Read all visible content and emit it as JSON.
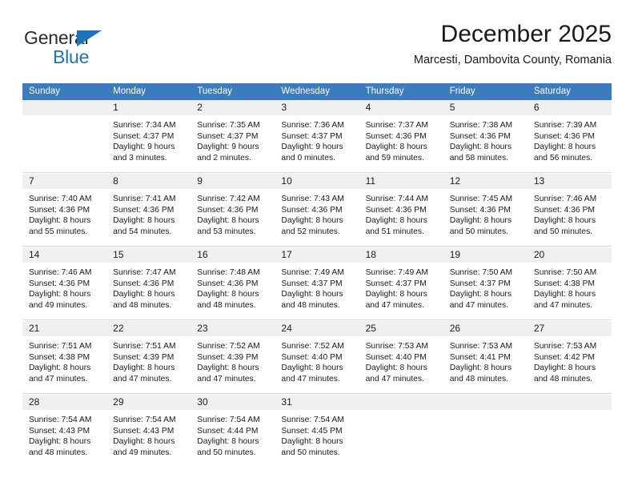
{
  "brand": {
    "name_part1": "General",
    "name_part2": "Blue",
    "triangle_color": "#1b75bb"
  },
  "header": {
    "month_title": "December 2025",
    "location": "Marcesti, Dambovita County, Romania",
    "header_bg": "#3a7cbf"
  },
  "weekday_headers": [
    "Sunday",
    "Monday",
    "Tuesday",
    "Wednesday",
    "Thursday",
    "Friday",
    "Saturday"
  ],
  "weeks": [
    [
      {
        "day": "",
        "sunrise": "",
        "sunset": "",
        "daylight1": "",
        "daylight2": ""
      },
      {
        "day": "1",
        "sunrise": "Sunrise: 7:34 AM",
        "sunset": "Sunset: 4:37 PM",
        "daylight1": "Daylight: 9 hours",
        "daylight2": "and 3 minutes."
      },
      {
        "day": "2",
        "sunrise": "Sunrise: 7:35 AM",
        "sunset": "Sunset: 4:37 PM",
        "daylight1": "Daylight: 9 hours",
        "daylight2": "and 2 minutes."
      },
      {
        "day": "3",
        "sunrise": "Sunrise: 7:36 AM",
        "sunset": "Sunset: 4:37 PM",
        "daylight1": "Daylight: 9 hours",
        "daylight2": "and 0 minutes."
      },
      {
        "day": "4",
        "sunrise": "Sunrise: 7:37 AM",
        "sunset": "Sunset: 4:36 PM",
        "daylight1": "Daylight: 8 hours",
        "daylight2": "and 59 minutes."
      },
      {
        "day": "5",
        "sunrise": "Sunrise: 7:38 AM",
        "sunset": "Sunset: 4:36 PM",
        "daylight1": "Daylight: 8 hours",
        "daylight2": "and 58 minutes."
      },
      {
        "day": "6",
        "sunrise": "Sunrise: 7:39 AM",
        "sunset": "Sunset: 4:36 PM",
        "daylight1": "Daylight: 8 hours",
        "daylight2": "and 56 minutes."
      }
    ],
    [
      {
        "day": "7",
        "sunrise": "Sunrise: 7:40 AM",
        "sunset": "Sunset: 4:36 PM",
        "daylight1": "Daylight: 8 hours",
        "daylight2": "and 55 minutes."
      },
      {
        "day": "8",
        "sunrise": "Sunrise: 7:41 AM",
        "sunset": "Sunset: 4:36 PM",
        "daylight1": "Daylight: 8 hours",
        "daylight2": "and 54 minutes."
      },
      {
        "day": "9",
        "sunrise": "Sunrise: 7:42 AM",
        "sunset": "Sunset: 4:36 PM",
        "daylight1": "Daylight: 8 hours",
        "daylight2": "and 53 minutes."
      },
      {
        "day": "10",
        "sunrise": "Sunrise: 7:43 AM",
        "sunset": "Sunset: 4:36 PM",
        "daylight1": "Daylight: 8 hours",
        "daylight2": "and 52 minutes."
      },
      {
        "day": "11",
        "sunrise": "Sunrise: 7:44 AM",
        "sunset": "Sunset: 4:36 PM",
        "daylight1": "Daylight: 8 hours",
        "daylight2": "and 51 minutes."
      },
      {
        "day": "12",
        "sunrise": "Sunrise: 7:45 AM",
        "sunset": "Sunset: 4:36 PM",
        "daylight1": "Daylight: 8 hours",
        "daylight2": "and 50 minutes."
      },
      {
        "day": "13",
        "sunrise": "Sunrise: 7:46 AM",
        "sunset": "Sunset: 4:36 PM",
        "daylight1": "Daylight: 8 hours",
        "daylight2": "and 50 minutes."
      }
    ],
    [
      {
        "day": "14",
        "sunrise": "Sunrise: 7:46 AM",
        "sunset": "Sunset: 4:36 PM",
        "daylight1": "Daylight: 8 hours",
        "daylight2": "and 49 minutes."
      },
      {
        "day": "15",
        "sunrise": "Sunrise: 7:47 AM",
        "sunset": "Sunset: 4:36 PM",
        "daylight1": "Daylight: 8 hours",
        "daylight2": "and 48 minutes."
      },
      {
        "day": "16",
        "sunrise": "Sunrise: 7:48 AM",
        "sunset": "Sunset: 4:36 PM",
        "daylight1": "Daylight: 8 hours",
        "daylight2": "and 48 minutes."
      },
      {
        "day": "17",
        "sunrise": "Sunrise: 7:49 AM",
        "sunset": "Sunset: 4:37 PM",
        "daylight1": "Daylight: 8 hours",
        "daylight2": "and 48 minutes."
      },
      {
        "day": "18",
        "sunrise": "Sunrise: 7:49 AM",
        "sunset": "Sunset: 4:37 PM",
        "daylight1": "Daylight: 8 hours",
        "daylight2": "and 47 minutes."
      },
      {
        "day": "19",
        "sunrise": "Sunrise: 7:50 AM",
        "sunset": "Sunset: 4:37 PM",
        "daylight1": "Daylight: 8 hours",
        "daylight2": "and 47 minutes."
      },
      {
        "day": "20",
        "sunrise": "Sunrise: 7:50 AM",
        "sunset": "Sunset: 4:38 PM",
        "daylight1": "Daylight: 8 hours",
        "daylight2": "and 47 minutes."
      }
    ],
    [
      {
        "day": "21",
        "sunrise": "Sunrise: 7:51 AM",
        "sunset": "Sunset: 4:38 PM",
        "daylight1": "Daylight: 8 hours",
        "daylight2": "and 47 minutes."
      },
      {
        "day": "22",
        "sunrise": "Sunrise: 7:51 AM",
        "sunset": "Sunset: 4:39 PM",
        "daylight1": "Daylight: 8 hours",
        "daylight2": "and 47 minutes."
      },
      {
        "day": "23",
        "sunrise": "Sunrise: 7:52 AM",
        "sunset": "Sunset: 4:39 PM",
        "daylight1": "Daylight: 8 hours",
        "daylight2": "and 47 minutes."
      },
      {
        "day": "24",
        "sunrise": "Sunrise: 7:52 AM",
        "sunset": "Sunset: 4:40 PM",
        "daylight1": "Daylight: 8 hours",
        "daylight2": "and 47 minutes."
      },
      {
        "day": "25",
        "sunrise": "Sunrise: 7:53 AM",
        "sunset": "Sunset: 4:40 PM",
        "daylight1": "Daylight: 8 hours",
        "daylight2": "and 47 minutes."
      },
      {
        "day": "26",
        "sunrise": "Sunrise: 7:53 AM",
        "sunset": "Sunset: 4:41 PM",
        "daylight1": "Daylight: 8 hours",
        "daylight2": "and 48 minutes."
      },
      {
        "day": "27",
        "sunrise": "Sunrise: 7:53 AM",
        "sunset": "Sunset: 4:42 PM",
        "daylight1": "Daylight: 8 hours",
        "daylight2": "and 48 minutes."
      }
    ],
    [
      {
        "day": "28",
        "sunrise": "Sunrise: 7:54 AM",
        "sunset": "Sunset: 4:43 PM",
        "daylight1": "Daylight: 8 hours",
        "daylight2": "and 48 minutes."
      },
      {
        "day": "29",
        "sunrise": "Sunrise: 7:54 AM",
        "sunset": "Sunset: 4:43 PM",
        "daylight1": "Daylight: 8 hours",
        "daylight2": "and 49 minutes."
      },
      {
        "day": "30",
        "sunrise": "Sunrise: 7:54 AM",
        "sunset": "Sunset: 4:44 PM",
        "daylight1": "Daylight: 8 hours",
        "daylight2": "and 50 minutes."
      },
      {
        "day": "31",
        "sunrise": "Sunrise: 7:54 AM",
        "sunset": "Sunset: 4:45 PM",
        "daylight1": "Daylight: 8 hours",
        "daylight2": "and 50 minutes."
      },
      {
        "day": "",
        "sunrise": "",
        "sunset": "",
        "daylight1": "",
        "daylight2": ""
      },
      {
        "day": "",
        "sunrise": "",
        "sunset": "",
        "daylight1": "",
        "daylight2": ""
      },
      {
        "day": "",
        "sunrise": "",
        "sunset": "",
        "daylight1": "",
        "daylight2": ""
      }
    ]
  ]
}
